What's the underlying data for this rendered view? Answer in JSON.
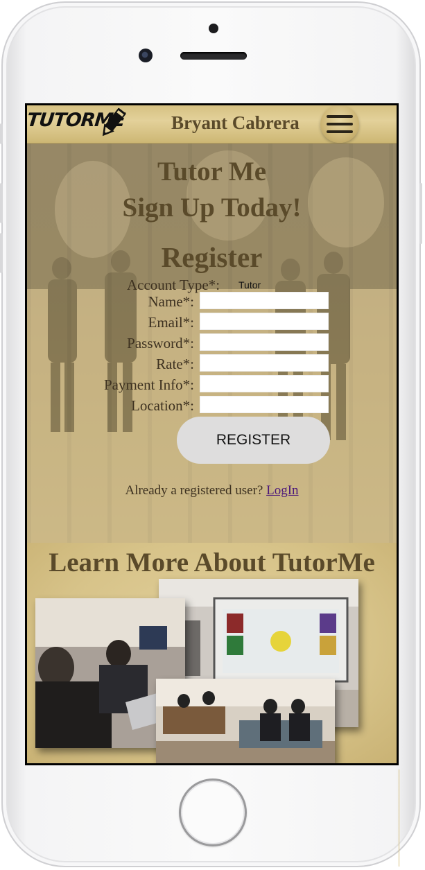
{
  "brand": {
    "logo_text": "TUTORME"
  },
  "nav": {
    "user_name": "Bryant Cabrera"
  },
  "hero": {
    "title_line1": "Tutor Me",
    "title_line2": "Sign Up Today!",
    "form_title": "Register",
    "account_type_label": "Account Type*:",
    "account_type_value": "Tutor",
    "fields": [
      {
        "label": "Name*:",
        "value": ""
      },
      {
        "label": "Email*:",
        "value": ""
      },
      {
        "label": "Password*:",
        "value": ""
      },
      {
        "label": "Rate*:",
        "value": ""
      },
      {
        "label": "Payment Info*:",
        "value": ""
      },
      {
        "label": "Location*:",
        "value": ""
      }
    ],
    "register_label": "REGISTER",
    "already_text": "Already a registered user?",
    "login_link": "LogIn"
  },
  "learn_more": {
    "title": "Learn More About TutorMe"
  },
  "colors": {
    "nav_gold": "#e3d19a",
    "heading_brown": "#5a4a2a",
    "link_purple": "#4b167a",
    "button_gray": "#dedddd"
  }
}
